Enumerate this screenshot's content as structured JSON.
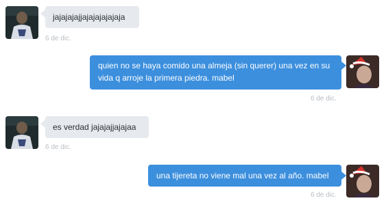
{
  "colors": {
    "incoming_bubble": "#e6e9ed",
    "outgoing_bubble": "#3c8fdd",
    "timestamp": "#b9bec3"
  },
  "messages": [
    {
      "direction": "in",
      "text": "jajajajajjajajajajajaja",
      "time": "6 de dic."
    },
    {
      "direction": "out",
      "text": "quien no se haya comido una almeja (sin querer) una vez en su vida q arroje la primera piedra. mabel",
      "time": "6 de dic."
    },
    {
      "direction": "in",
      "text": "es verdad jajajajjajajaa",
      "time": "6 de dic."
    },
    {
      "direction": "out",
      "text": "una tijereta no viene mal una vez al año. mabel",
      "time": "6 de dic."
    }
  ]
}
